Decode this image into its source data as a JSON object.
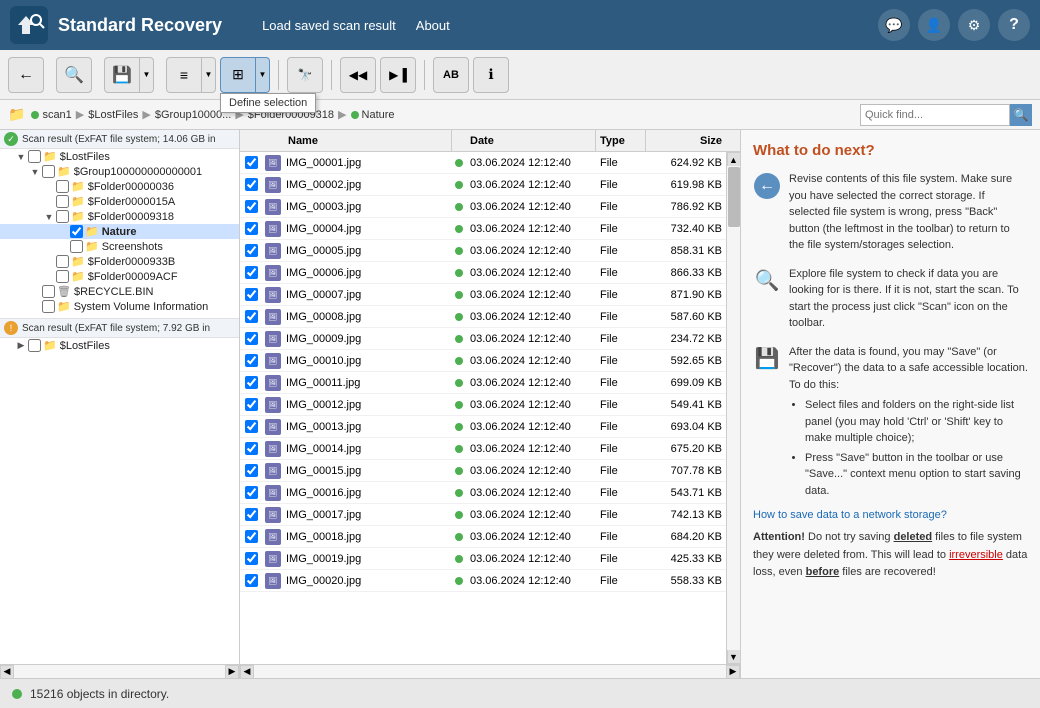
{
  "header": {
    "title": "Standard Recovery",
    "nav": {
      "load_scan": "Load saved scan result",
      "about": "About"
    },
    "icons": [
      "💬",
      "👤",
      "⚙",
      "?"
    ]
  },
  "toolbar": {
    "buttons": [
      {
        "name": "back",
        "icon": "←",
        "tooltip": "Back"
      },
      {
        "name": "scan",
        "icon": "🔍",
        "tooltip": "Scan"
      },
      {
        "name": "save",
        "icon": "💾",
        "tooltip": "Save"
      },
      {
        "name": "list-view",
        "icon": "≡",
        "tooltip": "List view"
      },
      {
        "name": "grid-view",
        "icon": "⊞",
        "tooltip": "Grid view",
        "active": true
      },
      {
        "name": "find",
        "icon": "⊞⊞",
        "tooltip": "Find"
      },
      {
        "name": "prev",
        "icon": "◀◀",
        "tooltip": "Previous"
      },
      {
        "name": "next",
        "icon": "▶▐",
        "tooltip": "Next"
      },
      {
        "name": "preview",
        "icon": "АB",
        "tooltip": "Preview"
      },
      {
        "name": "info",
        "icon": "ℹ",
        "tooltip": "Info"
      }
    ],
    "define_selection_popup": "Define selection"
  },
  "breadcrumb": {
    "items": [
      "scan1",
      "$LostFiles",
      "$Group10000000000001",
      "$Folder00009318",
      "Nature"
    ],
    "search_placeholder": "Quick find..."
  },
  "file_table": {
    "headers": [
      "Name",
      "Date",
      "Type",
      "Size"
    ],
    "rows": [
      {
        "name": "IMG_00001.jpg",
        "date": "03.06.2024 12:12:40",
        "type": "File",
        "size": "624.92 KB"
      },
      {
        "name": "IMG_00002.jpg",
        "date": "03.06.2024 12:12:40",
        "type": "File",
        "size": "619.98 KB"
      },
      {
        "name": "IMG_00003.jpg",
        "date": "03.06.2024 12:12:40",
        "type": "File",
        "size": "786.92 KB"
      },
      {
        "name": "IMG_00004.jpg",
        "date": "03.06.2024 12:12:40",
        "type": "File",
        "size": "732.40 KB"
      },
      {
        "name": "IMG_00005.jpg",
        "date": "03.06.2024 12:12:40",
        "type": "File",
        "size": "858.31 KB"
      },
      {
        "name": "IMG_00006.jpg",
        "date": "03.06.2024 12:12:40",
        "type": "File",
        "size": "866.33 KB"
      },
      {
        "name": "IMG_00007.jpg",
        "date": "03.06.2024 12:12:40",
        "type": "File",
        "size": "871.90 KB"
      },
      {
        "name": "IMG_00008.jpg",
        "date": "03.06.2024 12:12:40",
        "type": "File",
        "size": "587.60 KB"
      },
      {
        "name": "IMG_00009.jpg",
        "date": "03.06.2024 12:12:40",
        "type": "File",
        "size": "234.72 KB"
      },
      {
        "name": "IMG_00010.jpg",
        "date": "03.06.2024 12:12:40",
        "type": "File",
        "size": "592.65 KB"
      },
      {
        "name": "IMG_00011.jpg",
        "date": "03.06.2024 12:12:40",
        "type": "File",
        "size": "699.09 KB"
      },
      {
        "name": "IMG_00012.jpg",
        "date": "03.06.2024 12:12:40",
        "type": "File",
        "size": "549.41 KB"
      },
      {
        "name": "IMG_00013.jpg",
        "date": "03.06.2024 12:12:40",
        "type": "File",
        "size": "693.04 KB"
      },
      {
        "name": "IMG_00014.jpg",
        "date": "03.06.2024 12:12:40",
        "type": "File",
        "size": "675.20 KB"
      },
      {
        "name": "IMG_00015.jpg",
        "date": "03.06.2024 12:12:40",
        "type": "File",
        "size": "707.78 KB"
      },
      {
        "name": "IMG_00016.jpg",
        "date": "03.06.2024 12:12:40",
        "type": "File",
        "size": "543.71 KB"
      },
      {
        "name": "IMG_00017.jpg",
        "date": "03.06.2024 12:12:40",
        "type": "File",
        "size": "742.13 KB"
      },
      {
        "name": "IMG_00018.jpg",
        "date": "03.06.2024 12:12:40",
        "type": "File",
        "size": "684.20 KB"
      },
      {
        "name": "IMG_00019.jpg",
        "date": "03.06.2024 12:12:40",
        "type": "File",
        "size": "425.33 KB"
      },
      {
        "name": "IMG_00020.jpg",
        "date": "03.06.2024 12:12:40",
        "type": "File",
        "size": "558.33 KB"
      }
    ]
  },
  "file_tree": {
    "scan1": {
      "label": "Scan result (ExFAT file system; 14.06 GB in",
      "children": {
        "lost_files": {
          "label": "$LostFiles",
          "children": {
            "group": {
              "label": "$Group10000000000001",
              "children": {
                "folder36": "$Folder00000036",
                "folder15a": "$Folder0000015A",
                "folder9318": {
                  "label": "$Folder00009318",
                  "children": {
                    "nature": "Nature",
                    "screenshots": "Screenshots"
                  }
                },
                "folder933b": "$Folder0000933B",
                "folder9acf": "$Folder00009ACF"
              }
            }
          }
        },
        "recycle": "$RECYCLE.BIN",
        "sysvolume": "System Volume Information"
      }
    },
    "scan2": {
      "label": "Scan result (ExFAT file system; 7.92 GB in",
      "children": {
        "lost_files2": "$LostFiles"
      }
    }
  },
  "right_panel": {
    "title": "What to do next?",
    "sections": [
      {
        "icon": "arrow",
        "text": "Revise contents of this file system. Make sure you have selected the correct storage. If selected file system is wrong, press \"Back\" button (the leftmost in the toolbar) to return to the file system/storages selection."
      },
      {
        "icon": "magnify",
        "text": "Explore file system to check if data you are looking for is there. If it is not, start the scan. To start the process just click \"Scan\" icon on the toolbar."
      },
      {
        "icon": "save",
        "text": "After the data is found, you may \"Save\" (or \"Recover\") the data to a safe accessible location. To do this:",
        "bullets": [
          "Select files and folders on the right-side list panel (you may hold 'Ctrl' or 'Shift' key to make multiple choice);",
          "Press \"Save\" button in the toolbar or use \"Save...\" context menu option to start saving data."
        ]
      }
    ],
    "link": "How to save data to a network storage?",
    "attention": {
      "prefix": "Attention!",
      "text1": " Do not try saving ",
      "deleted": "deleted",
      "text2": " files to file system they were deleted from. This will lead to ",
      "irreversible": "irreversible",
      "text3": " data loss, even ",
      "before": "before",
      "text4": " files are recovered!"
    }
  },
  "status_bar": {
    "text": "15216 objects in directory."
  }
}
